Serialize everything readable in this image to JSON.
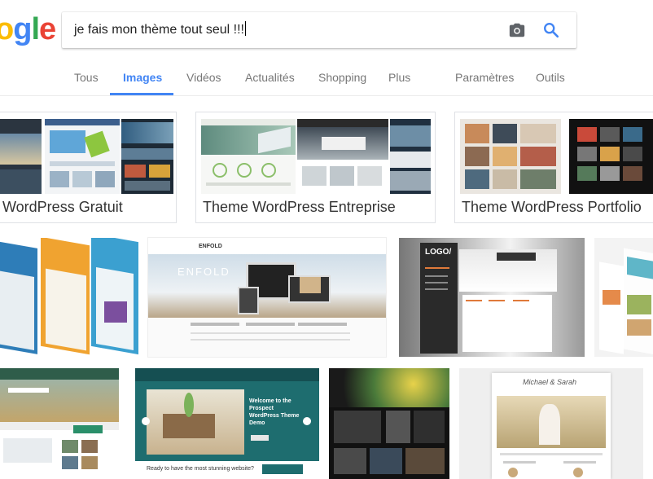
{
  "logo": {
    "letters": [
      "o",
      "g",
      "l",
      "e"
    ]
  },
  "search": {
    "query": "je fais mon thème tout seul !!!"
  },
  "tabs": [
    {
      "label": "Tous"
    },
    {
      "label": "Images"
    },
    {
      "label": "Vidéos"
    },
    {
      "label": "Actualités"
    },
    {
      "label": "Shopping"
    },
    {
      "label": "Plus"
    },
    {
      "label": "Paramètres"
    },
    {
      "label": "Outils"
    }
  ],
  "related": [
    {
      "label": "WordPress Gratuit"
    },
    {
      "label": "Theme WordPress Entreprise"
    },
    {
      "label": "Theme WordPress Portfolio"
    }
  ],
  "thumb_text": {
    "enfold": "ENFOLD",
    "logo": "LOGO/",
    "prospect_title": "Welcome to the Prospect WordPress Theme Demo",
    "prospect_footer": "Ready to have the most stunning website?",
    "wedding": "Michael & Sarah"
  },
  "colors": {
    "google_blue": "#4285f4",
    "google_red": "#ea4335",
    "google_yellow": "#fbbc05",
    "google_green": "#34a853"
  }
}
